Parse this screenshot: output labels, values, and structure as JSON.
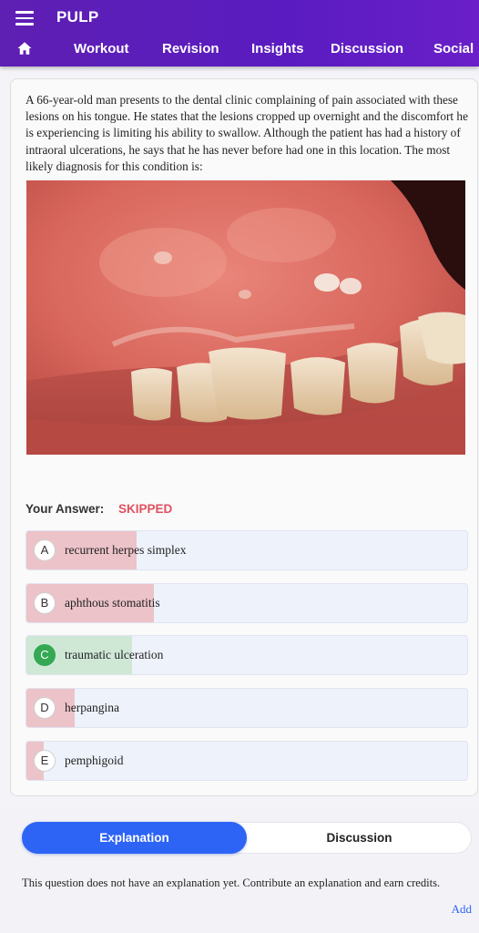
{
  "app": {
    "title": "PULP"
  },
  "nav": {
    "tabs": [
      {
        "label": "Workout"
      },
      {
        "label": "Revision"
      },
      {
        "label": "Insights"
      },
      {
        "label": "Discussion"
      },
      {
        "label": "Social"
      }
    ]
  },
  "question": {
    "text": "A 66-year-old man presents to the dental clinic complaining of pain associated with these lesions on his tongue. He states that the lesions cropped up overnight and the discomfort he is experiencing is limiting his ability to swallow. Although the patient has had a history of intraoral ulcerations, he says that he has never before had one in this location. The most likely diagnosis for this condition is:"
  },
  "answer": {
    "label": "Your Answer:",
    "value": "SKIPPED"
  },
  "options": [
    {
      "letter": "A",
      "text": "recurrent herpes simplex",
      "percent": 25,
      "correct": false
    },
    {
      "letter": "B",
      "text": "aphthous stomatitis",
      "percent": 29,
      "correct": false
    },
    {
      "letter": "C",
      "text": "traumatic ulceration",
      "percent": 24,
      "correct": true
    },
    {
      "letter": "D",
      "text": "herpangina",
      "percent": 11,
      "correct": false
    },
    {
      "letter": "E",
      "text": "pemphigoid",
      "percent": 4,
      "correct": false
    }
  ],
  "bottom": {
    "explanation_tab": "Explanation",
    "discussion_tab": "Discussion",
    "no_explanation_text": "This question does not have an explanation yet. Contribute an explanation and earn credits.",
    "add_label": "Add"
  },
  "colors": {
    "brand": "#5a1cc0",
    "accent_blue": "#2d64f5",
    "skipped_red": "#e05060",
    "correct_green": "#34a853",
    "wrong_fill": "#ecc3c9",
    "correct_fill": "#cfe8d6"
  },
  "icons": {
    "menu": "hamburger-menu-icon",
    "home": "home-icon"
  }
}
